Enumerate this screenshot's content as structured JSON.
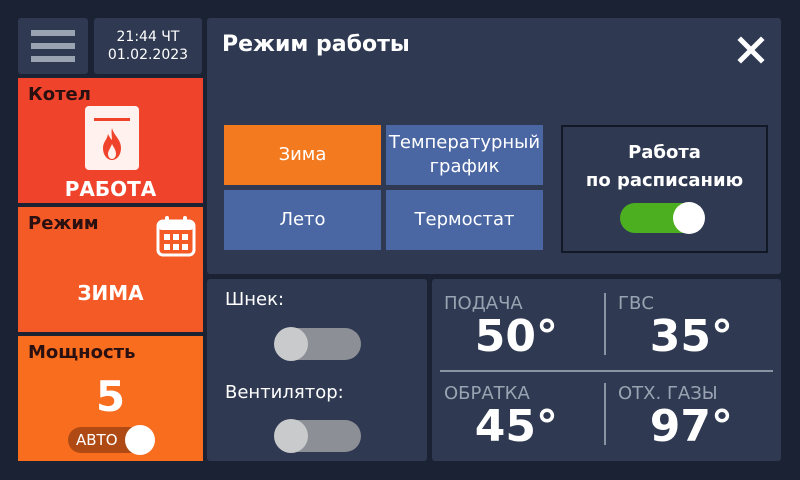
{
  "header": {
    "time": "21:44 ЧТ",
    "date": "01.02.2023"
  },
  "tiles": {
    "boiler": {
      "title": "Котел",
      "status": "РАБОТА",
      "icon": "boiler-flame-icon"
    },
    "mode": {
      "title": "Режим",
      "status": "ЗИМА",
      "icon": "calendar-icon"
    },
    "power": {
      "title": "Мощность",
      "value": "5",
      "auto_label": "АВТО",
      "auto_on": true
    }
  },
  "main_panel": {
    "title": "Режим работы",
    "buttons": [
      {
        "label": "Зима",
        "active": true
      },
      {
        "label": "Температурный график",
        "active": false
      },
      {
        "label": "Лето",
        "active": false
      },
      {
        "label": "Термостат",
        "active": false
      }
    ],
    "schedule": {
      "label_line1": "Работа",
      "label_line2": "по расписанию",
      "enabled": true
    }
  },
  "aux": {
    "auger": {
      "label": "Шнек:",
      "enabled": false
    },
    "fan": {
      "label": "Вентилятор:",
      "enabled": false
    }
  },
  "temps": {
    "supply": {
      "label": "ПОДАЧА",
      "value": "50°"
    },
    "dhw": {
      "label": "ГВС",
      "value": "35°"
    },
    "return": {
      "label": "ОБРАТКА",
      "value": "45°"
    },
    "flue": {
      "label": "ОТХ. ГАЗЫ",
      "value": "97°"
    }
  },
  "colors": {
    "background": "#1b2233",
    "panel": "#2f3a52",
    "active_button": "#f47a1f",
    "inactive_button": "#4a67a4",
    "toggle_on": "#4caf1f"
  }
}
